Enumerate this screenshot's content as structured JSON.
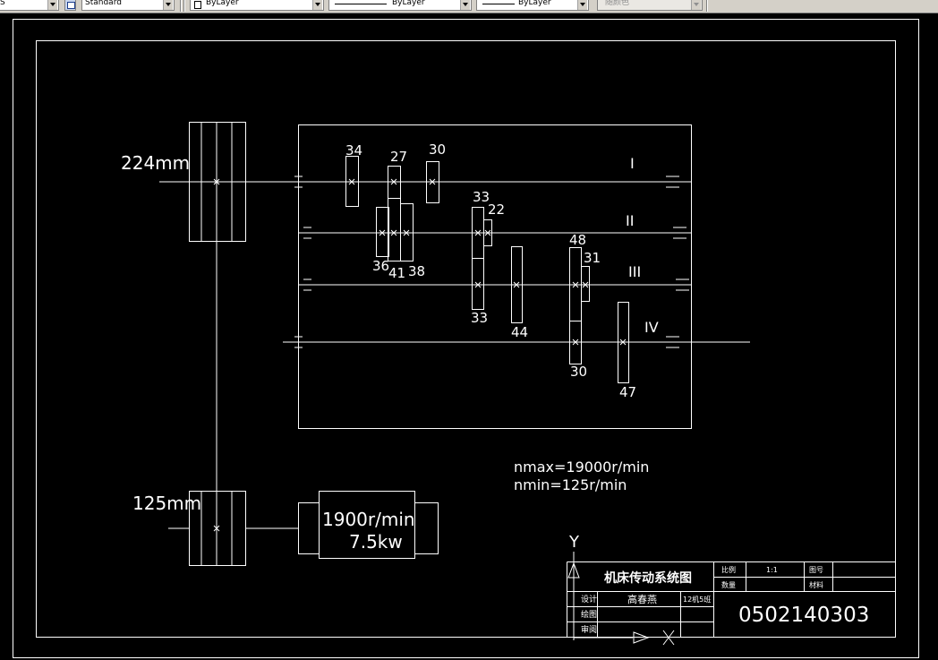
{
  "toolbar": {
    "first_combo_value": "S",
    "text_style": "Standard",
    "layer": "ByLayer",
    "linetype": "ByLayer",
    "lineweight": "ByLayer",
    "plot_style": "随颜色"
  },
  "drawing": {
    "motor_pulley_diameter": "224mm",
    "spindle_pulley_diameter": "125mm",
    "motor_speed": "1900r/min",
    "motor_power": "7.5kw",
    "nmax": "nmax=19000r/min",
    "nmin": "nmin=125r/min",
    "shafts": [
      "I",
      "II",
      "III",
      "IV"
    ],
    "gear_teeth": {
      "shaft1_a": "34",
      "shaft1_b": "27",
      "shaft1_c": "30",
      "shaft2_a": "36",
      "shaft2_b": "41",
      "shaft2_c": "38",
      "shaft2_d": "33",
      "shaft2_e": "22",
      "shaft3_a": "33",
      "shaft3_b": "44",
      "shaft3_c": "48",
      "shaft3_d": "31",
      "shaft4_a": "30",
      "shaft4_b": "47"
    },
    "ucs_y": "Y",
    "title_block": {
      "title": "机床传动系统图",
      "scale_label": "比例",
      "scale_value": "1:1",
      "drawing_no_label": "图号",
      "quantity_label": "数量",
      "material_label": "材料",
      "design_label": "设计",
      "designer": "高春燕",
      "class_label": "12机5班",
      "draw_label": "绘图",
      "review_label": "审阅",
      "student_number": "0502140303"
    }
  }
}
